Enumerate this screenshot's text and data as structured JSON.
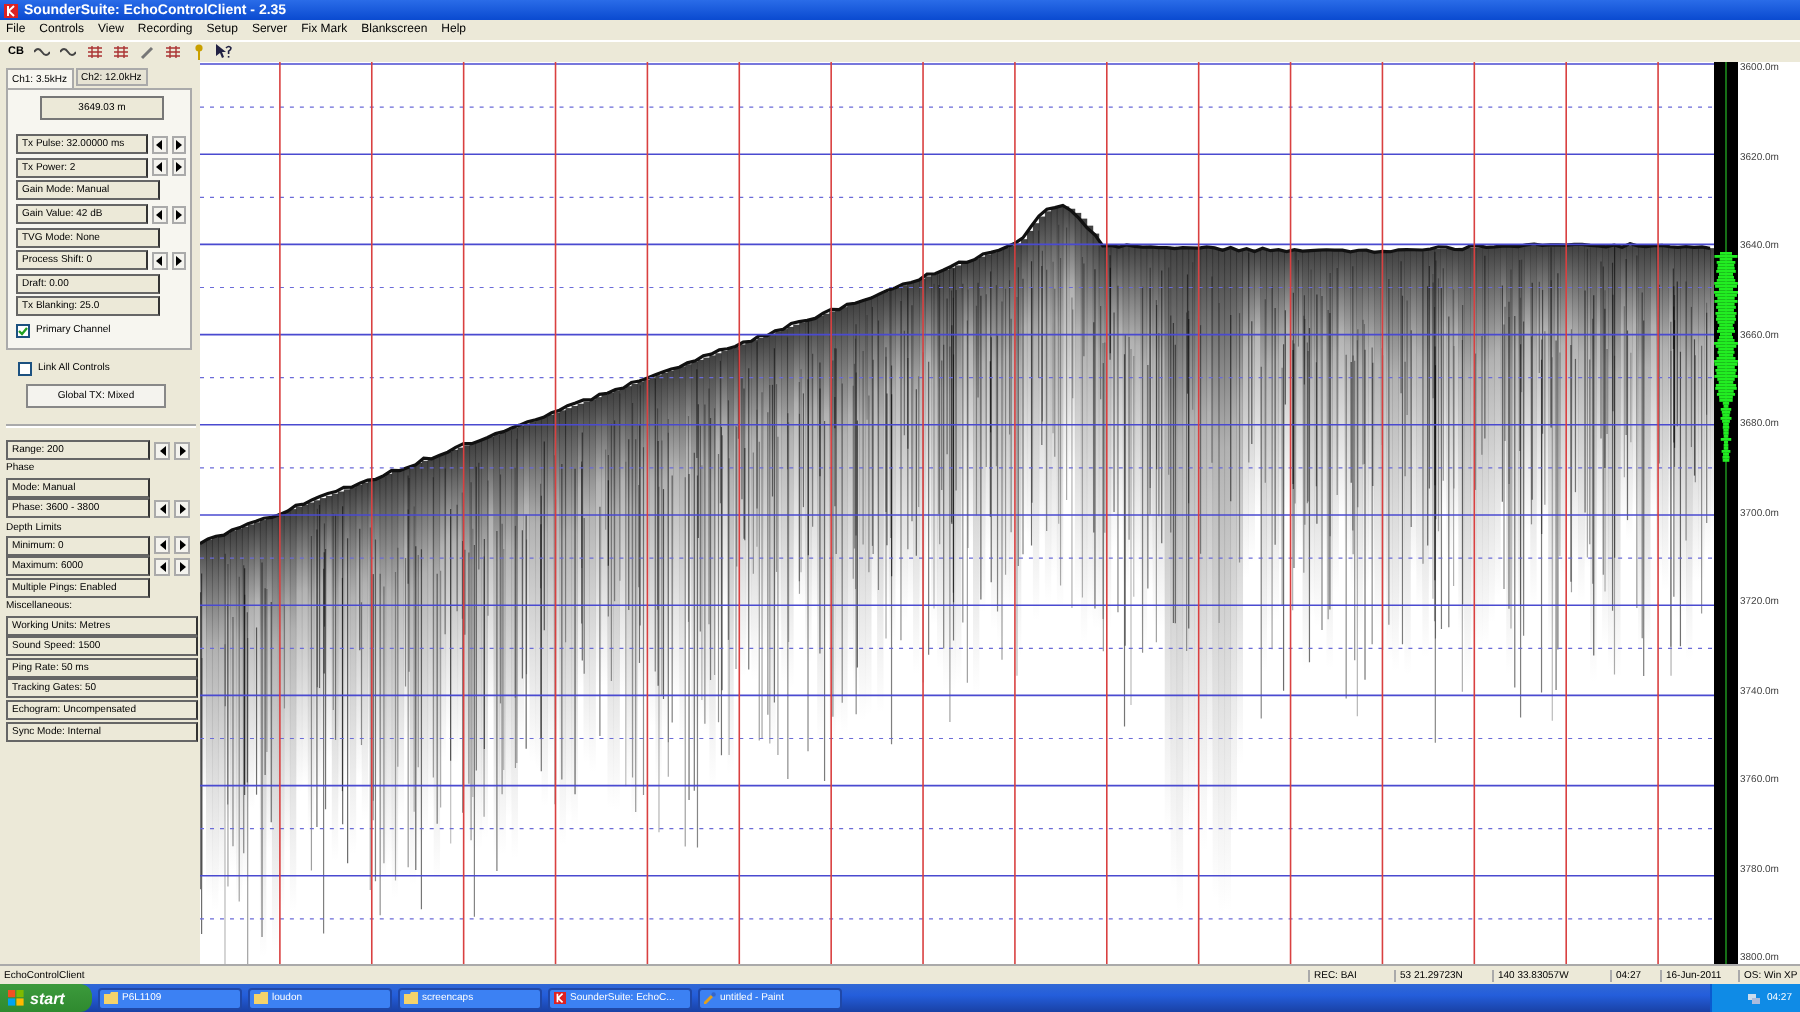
{
  "window": {
    "title": "SounderSuite: EchoControlClient - 2.35"
  },
  "menu": [
    "File",
    "Controls",
    "View",
    "Recording",
    "Setup",
    "Server",
    "Fix Mark",
    "Blankscreen",
    "Help"
  ],
  "toolbar": [
    {
      "kind": "text",
      "label": "CB"
    },
    {
      "kind": "wave"
    },
    {
      "kind": "wave"
    },
    {
      "kind": "grid"
    },
    {
      "kind": "grid"
    },
    {
      "kind": "pencil"
    },
    {
      "kind": "grid"
    },
    {
      "kind": "key"
    },
    {
      "kind": "help"
    }
  ],
  "channel_tabs": [
    {
      "label": "Ch1: 3.5kHz",
      "selected": true
    },
    {
      "label": "Ch2: 12.0kHz",
      "selected": false
    }
  ],
  "depth_readout": "3649.03 m",
  "channel_controls": [
    {
      "label": "Tx Pulse: 32.00000 ms",
      "kind": "stepper"
    },
    {
      "label": "Tx Power: 2",
      "kind": "stepper"
    },
    {
      "label": "Gain Mode: Manual",
      "kind": "plain"
    },
    {
      "label": "Gain Value: 42 dB",
      "kind": "stepper"
    },
    {
      "label": "TVG Mode: None",
      "kind": "plain"
    },
    {
      "label": "Process Shift: 0",
      "kind": "stepper"
    },
    {
      "label": "Draft: 0.00",
      "kind": "plain"
    },
    {
      "label": "Tx Blanking: 25.0",
      "kind": "plain"
    }
  ],
  "primary_channel": {
    "label": "Primary Channel",
    "checked": true
  },
  "link_all_controls": {
    "label": "Link All Controls",
    "checked": false
  },
  "global_button": "Global TX: Mixed",
  "global_controls": [
    {
      "label": "Range: 200",
      "kind": "stepper"
    },
    {
      "label": "Phase",
      "kind": "heading"
    },
    {
      "label": "Mode: Manual",
      "kind": "plain"
    },
    {
      "label": "Phase: 3600 - 3800",
      "kind": "stepper"
    },
    {
      "label": "Depth Limits",
      "kind": "heading"
    },
    {
      "label": "Minimum: 0",
      "kind": "stepper"
    },
    {
      "label": "Maximum: 6000",
      "kind": "stepper"
    },
    {
      "label": "Multiple Pings: Enabled",
      "kind": "plain"
    },
    {
      "label": "Miscellaneous:",
      "kind": "heading"
    },
    {
      "label": "Working Units: Metres",
      "kind": "wide"
    },
    {
      "label": "Sound Speed: 1500",
      "kind": "wide"
    },
    {
      "label": "Ping Rate: 50 ms",
      "kind": "wide"
    },
    {
      "label": "Tracking Gates: 50",
      "kind": "wide"
    },
    {
      "label": "Echogram: Uncompensated",
      "kind": "wide"
    },
    {
      "label": "Sync Mode: Internal",
      "kind": "wide"
    }
  ],
  "depth_scale": [
    "3600.0m",
    "3620.0m",
    "3640.0m",
    "3660.0m",
    "3680.0m",
    "3700.0m",
    "3720.0m",
    "3740.0m",
    "3760.0m",
    "3780.0m",
    "3800.0m"
  ],
  "status_bar": {
    "app": "EchoControlClient",
    "fields": [
      "REC: BAI",
      "53 21.29723N",
      "140 33.83057W",
      "04:27",
      "16-Jun-2011",
      "OS: Win XP"
    ]
  },
  "taskbar": {
    "start": "start",
    "tasks": [
      {
        "label": "P6L1109",
        "kind": "folder"
      },
      {
        "label": "loudon",
        "kind": "folder"
      },
      {
        "label": "screencaps",
        "kind": "folder"
      },
      {
        "label": "SounderSuite: EchoC...",
        "kind": "app"
      },
      {
        "label": "untitled - Paint",
        "kind": "paint"
      }
    ],
    "clock": "04:27"
  }
}
